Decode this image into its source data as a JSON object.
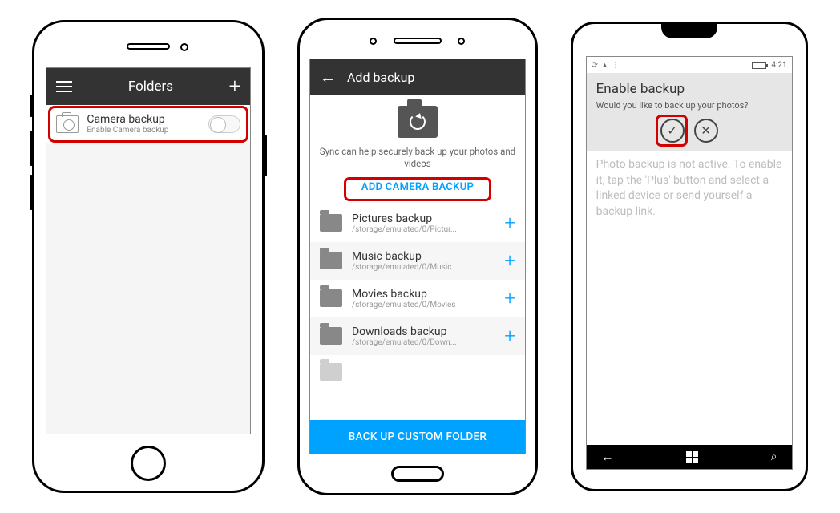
{
  "iphone": {
    "header_title": "Folders",
    "row": {
      "title": "Camera backup",
      "subtitle": "Enable Camera backup"
    }
  },
  "android": {
    "header_title": "Add backup",
    "hero_desc": "Sync can help securely back up your photos and videos",
    "add_camera_btn": "ADD CAMERA BACKUP",
    "items": [
      {
        "title": "Pictures backup",
        "path": "/storage/emulated/0/Pictur..."
      },
      {
        "title": "Music backup",
        "path": "/storage/emulated/0/Music"
      },
      {
        "title": "Movies backup",
        "path": "/storage/emulated/0/Movies"
      },
      {
        "title": "Downloads backup",
        "path": "/storage/emulated/0/Down..."
      }
    ],
    "bottom_btn": "BACK UP CUSTOM FOLDER"
  },
  "winphone": {
    "status_time": "4:21",
    "dialog": {
      "title": "Enable backup",
      "text": "Would you like to back up your photos?"
    },
    "help_text": "Photo backup is not active. To enable it, tap the 'Plus' button and select a linked device or send yourself a backup link."
  }
}
